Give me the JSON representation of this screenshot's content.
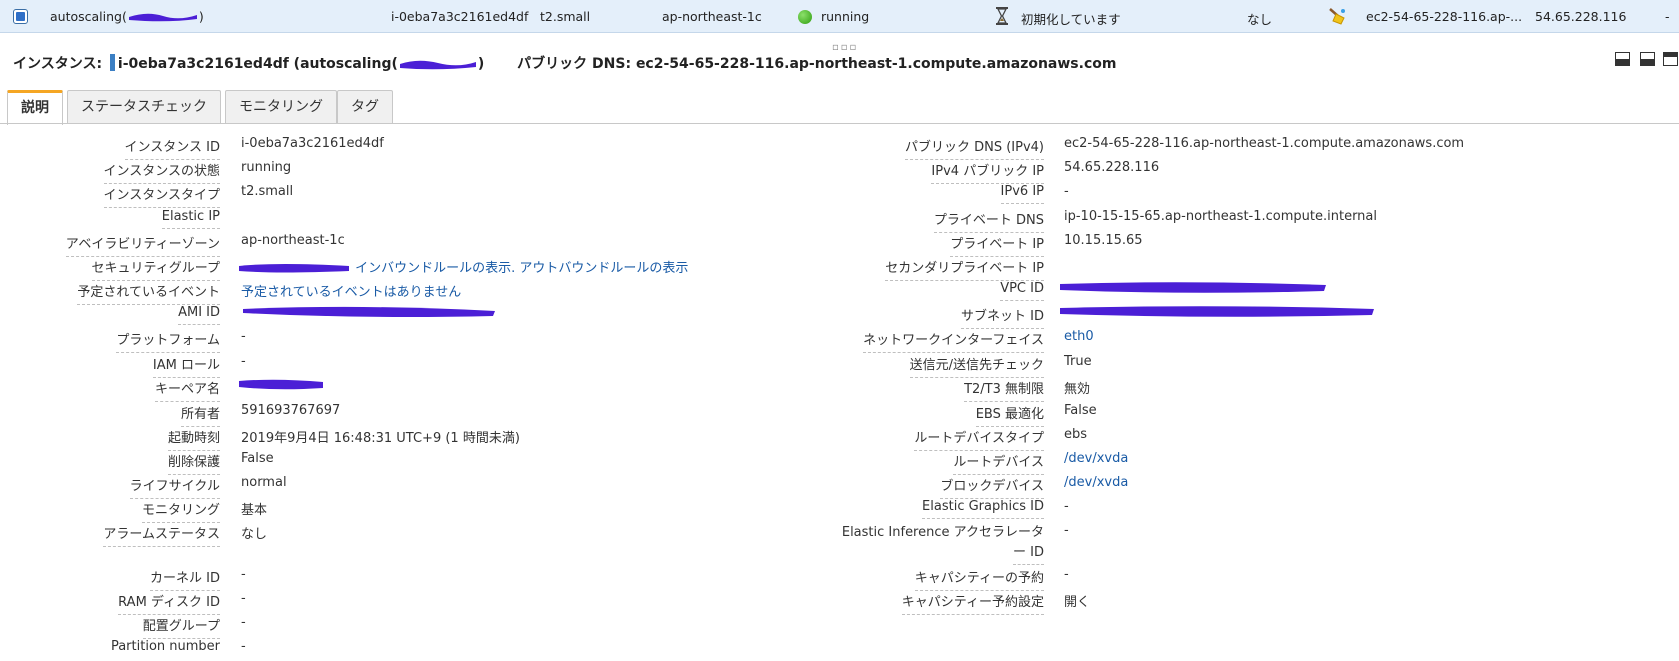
{
  "top_row": {
    "name": "autoscaling(",
    "name_suffix": ")",
    "instance_id": "i-0eba7a3c2161ed4df",
    "type": "t2.small",
    "az": "ap-northeast-1c",
    "state": "running",
    "status_check": "初期化しています",
    "alarm": "なし",
    "dns": "ec2-54-65-228-116.ap-...",
    "ip": "54.65.228.116",
    "extra": "-"
  },
  "header": {
    "prefix": "インスタンス:",
    "instance": "i-0eba7a3c2161ed4df (autoscaling(",
    "instance_end": ")",
    "dns_label": "パブリック DNS:",
    "dns": "ec2-54-65-228-116.ap-northeast-1.compute.amazonaws.com"
  },
  "splitter": "▫▫▫",
  "tabs": [
    "説明",
    "ステータスチェック",
    "モニタリング",
    "タグ"
  ],
  "left": [
    {
      "label": "インスタンス ID",
      "value": "i-0eba7a3c2161ed4df"
    },
    {
      "label": "インスタンスの状態",
      "value": "running"
    },
    {
      "label": "インスタンスタイプ",
      "value": "t2.small"
    },
    {
      "label": "Elastic IP",
      "value": ""
    },
    {
      "label": "アベイラビリティーゾーン",
      "value": "ap-northeast-1c"
    },
    {
      "label": "セキュリティグループ",
      "value": "インバウンドルールの表示. アウトバウンドルールの表示"
    },
    {
      "label": "予定されているイベント",
      "value": "予定されているイベントはありません"
    },
    {
      "label": "AMI ID",
      "value": ""
    },
    {
      "label": "プラットフォーム",
      "value": "-"
    },
    {
      "label": "IAM ロール",
      "value": "-"
    },
    {
      "label": "キーペア名",
      "value": ""
    },
    {
      "label": "所有者",
      "value": "591693767697"
    },
    {
      "label": "起動時刻",
      "value": "2019年9月4日 16:48:31 UTC+9 (1 時間未満)"
    },
    {
      "label": "削除保護",
      "value": "False"
    },
    {
      "label": "ライフサイクル",
      "value": "normal"
    },
    {
      "label": "モニタリング",
      "value": "基本"
    },
    {
      "label": "アラームステータス",
      "value": "なし"
    },
    {
      "label": "カーネル ID",
      "value": "-"
    },
    {
      "label": "RAM ディスク ID",
      "value": "-"
    },
    {
      "label": "配置グループ",
      "value": "-"
    },
    {
      "label": "Partition number",
      "value": "-"
    }
  ],
  "right": [
    {
      "label": "パブリック DNS (IPv4)",
      "value": "ec2-54-65-228-116.ap-northeast-1.compute.amazonaws.com"
    },
    {
      "label": "IPv4 パブリック IP",
      "value": "54.65.228.116"
    },
    {
      "label": "IPv6 IP",
      "value": "-"
    },
    {
      "label": "プライベート DNS",
      "value": "ip-10-15-15-65.ap-northeast-1.compute.internal"
    },
    {
      "label": "プライベート IP",
      "value": "10.15.15.65"
    },
    {
      "label": "セカンダリプライベート IP",
      "value": ""
    },
    {
      "label": "VPC ID",
      "value": ""
    },
    {
      "label": "サブネット ID",
      "value": ""
    },
    {
      "label": "ネットワークインターフェイス",
      "value": "eth0"
    },
    {
      "label": "送信元/送信先チェック",
      "value": "True"
    },
    {
      "label": "T2/T3 無制限",
      "value": "無効"
    },
    {
      "label": "EBS 最適化",
      "value": "False"
    },
    {
      "label": "ルートデバイスタイプ",
      "value": "ebs"
    },
    {
      "label": "ルートデバイス",
      "value": "/dev/xvda"
    },
    {
      "label": "ブロックデバイス",
      "value": "/dev/xvda"
    },
    {
      "label": "Elastic Graphics ID",
      "value": "-"
    },
    {
      "label": "Elastic Inference アクセラレータ",
      "label2": "ー ID",
      "value": "-"
    },
    {
      "label": "キャパシティーの予約",
      "value": "-"
    },
    {
      "label": "キャパシティー予約設定",
      "value": "開く"
    }
  ],
  "colors": {
    "row_highlight": "#e4effa",
    "link": "#1a5ba6",
    "tab_accent": "#f5a623",
    "redaction": "#4b1fd6"
  },
  "icons": [
    "checkbox-icon",
    "running-status-icon",
    "hourglass-icon",
    "broom-icon",
    "panel-bottom-icon",
    "panel-split-icon",
    "panel-top-icon"
  ]
}
